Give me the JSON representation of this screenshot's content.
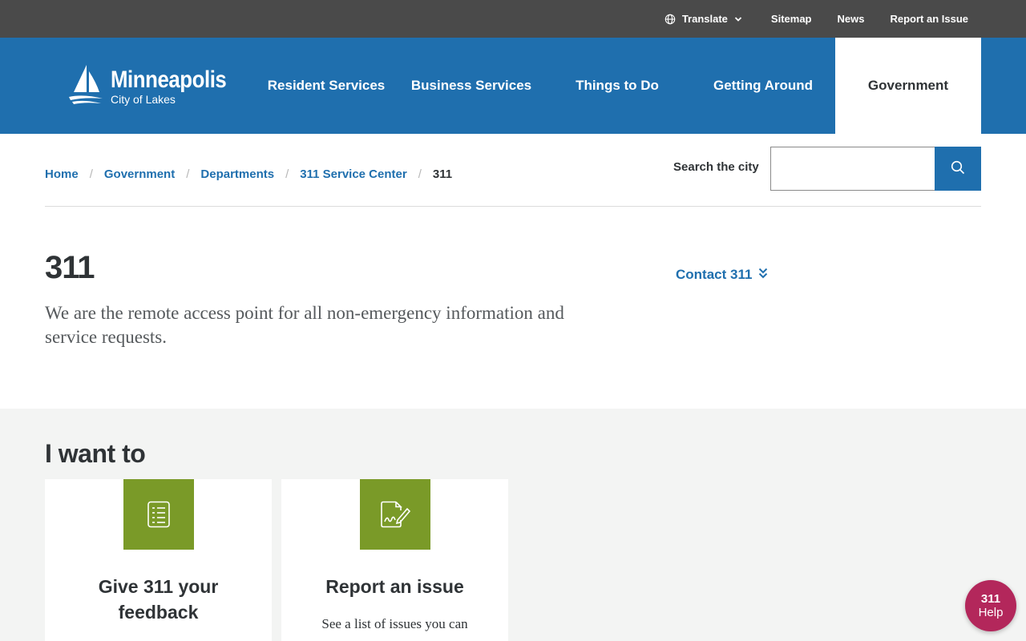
{
  "utility_bar": {
    "translate_label": "Translate",
    "sitemap_label": "Sitemap",
    "news_label": "News",
    "report_label": "Report an Issue"
  },
  "header": {
    "logo_name": "Minneapolis",
    "logo_tagline": "City of Lakes",
    "nav": [
      {
        "label": "Resident Services"
      },
      {
        "label": "Business Services"
      },
      {
        "label": "Things to Do"
      },
      {
        "label": "Getting Around"
      },
      {
        "label": "Government",
        "active": true
      }
    ]
  },
  "breadcrumb": {
    "items": [
      "Home",
      "Government",
      "Departments",
      "311 Service Center"
    ],
    "current": "311"
  },
  "search": {
    "label": "Search the city",
    "value": "",
    "placeholder": ""
  },
  "hero": {
    "title": "311",
    "description": "We are the remote access point for all non-emergency information and service requests.",
    "contact_label": "Contact 311"
  },
  "want": {
    "title": "I want to",
    "cards": [
      {
        "title": "Give 311 your feedback",
        "icon": "list-document-icon",
        "description": ""
      },
      {
        "title": "Report an issue",
        "icon": "signed-document-icon",
        "description": "See a list of issues you can"
      }
    ]
  },
  "help_bubble": {
    "number": "311",
    "label": "Help"
  },
  "colors": {
    "utility_bg": "#4a4a4a",
    "brand_blue": "#1f6fae",
    "card_icon_green": "#7a9a28",
    "section_bg": "#f3f4f3",
    "help_magenta": "#b3275b"
  }
}
